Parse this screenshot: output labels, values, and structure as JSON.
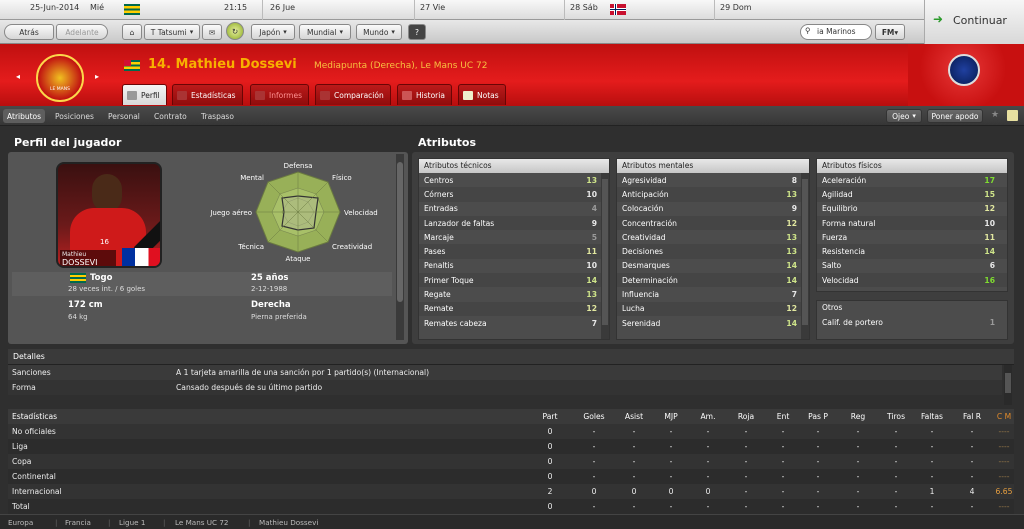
{
  "topbar": {
    "date": "25-Jun-2014",
    "weekday": "Mié",
    "time": "21:15",
    "days": [
      "26 Jue",
      "27 Vie",
      "28 Sáb",
      "29 Dom"
    ],
    "continue_label": "Continuar"
  },
  "nav": {
    "back": "Atrás",
    "forward": "Adelante",
    "manager": "T Tatsumi",
    "japan": "Japón",
    "world_cup": "Mundial",
    "world": "Mundo",
    "search_value": "ia Marinos",
    "fm_menu": "FM"
  },
  "player": {
    "title": "14. Mathieu Dossevi",
    "position_club": "Mediapunta (Derecha), Le Mans UC 72",
    "club_badge_text": "LE MANS",
    "nationality": "Togo",
    "caps": "28 veces int. / 6 goles",
    "age": "25 años",
    "birth": "2-12-1988",
    "height": "172 cm",
    "weight": "64 kg",
    "foot": "Derecha",
    "foot_label": "Pierna preferida",
    "photo_name_top": "Mathieu",
    "photo_name_bottom": "DOSSEVI",
    "shirt_number": "16",
    "radar_labels": [
      "Defensa",
      "Físico",
      "Velocidad",
      "Creatividad",
      "Ataque",
      "Técnica",
      "Juego aéreo",
      "Mental"
    ]
  },
  "tabs": [
    "Perfil",
    "Estadísticas",
    "Informes",
    "Comparación",
    "Historia",
    "Notas"
  ],
  "subnav": [
    "Atributos",
    "Posiciones",
    "Personal",
    "Contrato",
    "Traspaso"
  ],
  "subnav_right": {
    "scout": "Ojeo",
    "shortlist": "Poner apodo"
  },
  "sections": {
    "profile": "Perfil del jugador",
    "attributes": "Atributos"
  },
  "technical": {
    "title": "Atributos técnicos",
    "rows": [
      [
        "Centros",
        13
      ],
      [
        "Córners",
        10
      ],
      [
        "Entradas",
        4
      ],
      [
        "Lanzador de faltas",
        9
      ],
      [
        "Marcaje",
        5
      ],
      [
        "Pases",
        11
      ],
      [
        "Penaltis",
        10
      ],
      [
        "Primer Toque",
        14
      ],
      [
        "Regate",
        13
      ],
      [
        "Remate",
        12
      ],
      [
        "Remates cabeza",
        7
      ]
    ]
  },
  "mental": {
    "title": "Atributos mentales",
    "rows": [
      [
        "Agresividad",
        8
      ],
      [
        "Anticipación",
        13
      ],
      [
        "Colocación",
        9
      ],
      [
        "Concentración",
        12
      ],
      [
        "Creatividad",
        13
      ],
      [
        "Decisiones",
        13
      ],
      [
        "Desmarques",
        14
      ],
      [
        "Determinación",
        14
      ],
      [
        "Influencia",
        7
      ],
      [
        "Lucha",
        12
      ],
      [
        "Serenidad",
        14
      ]
    ]
  },
  "physical": {
    "title": "Atributos físicos",
    "rows": [
      [
        "Aceleración",
        17
      ],
      [
        "Agilidad",
        15
      ],
      [
        "Equilibrio",
        12
      ],
      [
        "Forma natural",
        10
      ],
      [
        "Fuerza",
        11
      ],
      [
        "Resistencia",
        14
      ],
      [
        "Salto",
        6
      ],
      [
        "Velocidad",
        16
      ]
    ]
  },
  "others": {
    "title": "Otros",
    "rows": [
      [
        "Calif. de portero",
        1
      ]
    ]
  },
  "details": {
    "title": "Detalles",
    "rows": [
      [
        "Sanciones",
        "A 1 tarjeta amarilla de una sanción por 1 partido(s) (Internacional)"
      ],
      [
        "Forma",
        "Cansado después de su último partido"
      ]
    ]
  },
  "stats": {
    "headers": [
      "Estadísticas",
      "Part",
      "Goles",
      "Asist",
      "MJP",
      "Am.",
      "Roja",
      "Ent",
      "Pas P",
      "Reg",
      "Tiros",
      "Faltas",
      "Fal R",
      "C M"
    ],
    "rows": [
      [
        "No oficiales",
        "0",
        "-",
        "-",
        "-",
        "-",
        "-",
        "-",
        "-",
        "-",
        "-",
        "-",
        "-",
        "----"
      ],
      [
        "Liga",
        "0",
        "-",
        "-",
        "-",
        "-",
        "-",
        "-",
        "-",
        "-",
        "-",
        "-",
        "-",
        "----"
      ],
      [
        "Copa",
        "0",
        "-",
        "-",
        "-",
        "-",
        "-",
        "-",
        "-",
        "-",
        "-",
        "-",
        "-",
        "----"
      ],
      [
        "Continental",
        "0",
        "-",
        "-",
        "-",
        "-",
        "-",
        "-",
        "-",
        "-",
        "-",
        "-",
        "-",
        "----"
      ],
      [
        "Internacional",
        "2",
        "0",
        "0",
        "0",
        "0",
        "-",
        "-",
        "-",
        "-",
        "-",
        "1",
        "4",
        "6.65"
      ],
      [
        "Total",
        "0",
        "-",
        "-",
        "-",
        "-",
        "-",
        "-",
        "-",
        "-",
        "-",
        "-",
        "-",
        "----"
      ]
    ]
  },
  "footer": [
    "Europa",
    "Francia",
    "Ligue 1",
    "Le Mans UC 72",
    "Mathieu Dossevi"
  ],
  "colors": {
    "header_red": "#d81818",
    "accent_orange": "#f0a020",
    "green_continue": "#2a9a2a"
  }
}
